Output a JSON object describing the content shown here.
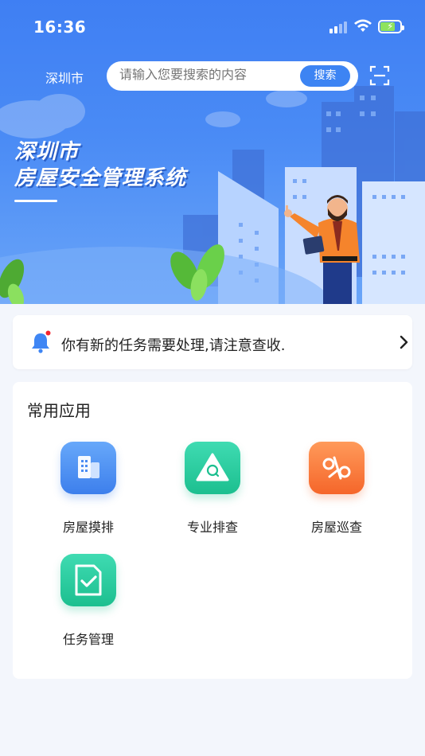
{
  "status_bar": {
    "time": "16:36",
    "icons": [
      "signal-icon",
      "wifi-icon",
      "battery-charging-icon"
    ]
  },
  "header": {
    "city": "深圳市",
    "search": {
      "placeholder": "请输入您要搜索的内容",
      "button_label": "搜索"
    },
    "scan_icon": "scan-icon"
  },
  "banner": {
    "title_line1": "深圳市",
    "title_line2": "房屋安全管理系统"
  },
  "notice": {
    "icon": "bell-icon",
    "text": "你有新的任务需要处理,请注意查收.",
    "chevron": "chevron-right-icon"
  },
  "apps": {
    "title": "常用应用",
    "items": [
      {
        "label": "房屋摸排",
        "icon": "building-icon",
        "color": "#4a8cf3"
      },
      {
        "label": "专业排查",
        "icon": "warning-search-icon",
        "color": "#22c796"
      },
      {
        "label": "房屋巡查",
        "icon": "patrol-icon",
        "color": "#f97638"
      },
      {
        "label": "任务管理",
        "icon": "task-check-icon",
        "color": "#22c796"
      }
    ]
  },
  "colors": {
    "primary": "#3d84f3",
    "background": "#f3f6fc",
    "notice_dot": "#f5222d"
  }
}
